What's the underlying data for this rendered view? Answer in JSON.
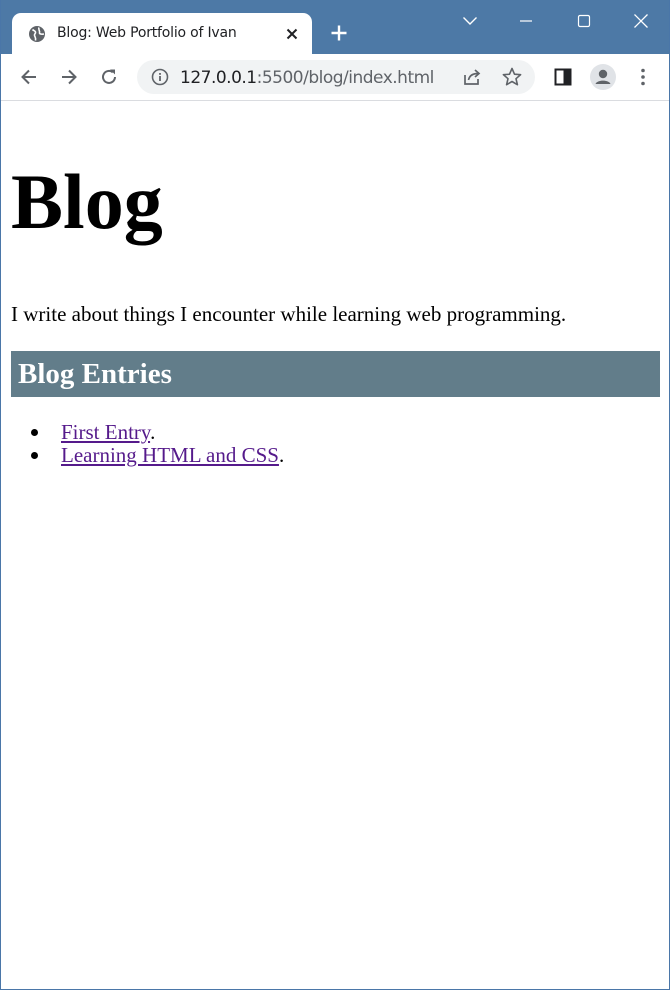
{
  "browser": {
    "tab": {
      "title": "Blog: Web Portfolio of Ivan"
    },
    "address": {
      "host": "127.0.0.1",
      "rest": ":5500/blog/index.html"
    },
    "icons": {
      "favicon": "globe-icon",
      "close": "close-icon",
      "new_tab": "plus-icon",
      "tab_search": "chevron-down-icon",
      "minimize": "minimize-icon",
      "maximize": "maximize-icon",
      "window_close": "close-icon",
      "back": "arrow-left-icon",
      "forward": "arrow-right-icon",
      "reload": "reload-icon",
      "site_info": "info-icon",
      "share": "share-icon",
      "bookmark": "star-icon",
      "side_panel": "side-panel-icon",
      "profile": "profile-icon",
      "menu": "kebab-menu-icon"
    },
    "colors": {
      "frame": "#4d79a6",
      "omnibox": "#f1f3f4"
    }
  },
  "page": {
    "title": "Blog",
    "intro": "I write about things I encounter while learning web programming.",
    "section_heading": "Blog Entries",
    "entries": [
      {
        "link": "First Entry",
        "suffix": "."
      },
      {
        "link": "Learning HTML and CSS",
        "suffix": "."
      }
    ],
    "colors": {
      "heading_bg": "#627d8a",
      "visited_link": "#551a8b"
    }
  }
}
